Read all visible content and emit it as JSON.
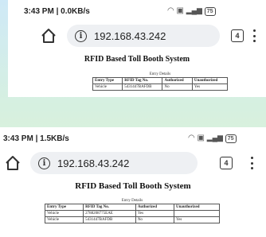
{
  "screens": [
    {
      "status": {
        "time": "3:43 PM | 0.0KB/s",
        "battery": "75"
      },
      "browser": {
        "url": "192.168.43.242",
        "tab_count": "4"
      },
      "page": {
        "title": "RFID Based Toll Booth System",
        "table_caption": "Entry Details",
        "headers": [
          "Entry Type",
          "RFID Tag No.",
          "Authorized",
          "Unauthorized"
        ],
        "rows": [
          [
            "Vehicle",
            "5431447BAFDB",
            "No",
            "Yes"
          ]
        ]
      }
    },
    {
      "status": {
        "time": "3:43 PM | 1.5KB/s",
        "battery": "75"
      },
      "browser": {
        "url": "192.168.43.242",
        "tab_count": "4"
      },
      "page": {
        "title": "RFID Based Toll Booth System",
        "table_caption": "Entry Details",
        "headers": [
          "Entry Type",
          "RFID Tag No.",
          "Authorized",
          "Unauthorized"
        ],
        "rows": [
          [
            "Vehicle",
            "2788208775EAE",
            "Yes",
            ""
          ],
          [
            "Vehicle",
            "5431447BAFDB",
            "No",
            "Yes"
          ]
        ]
      }
    }
  ]
}
